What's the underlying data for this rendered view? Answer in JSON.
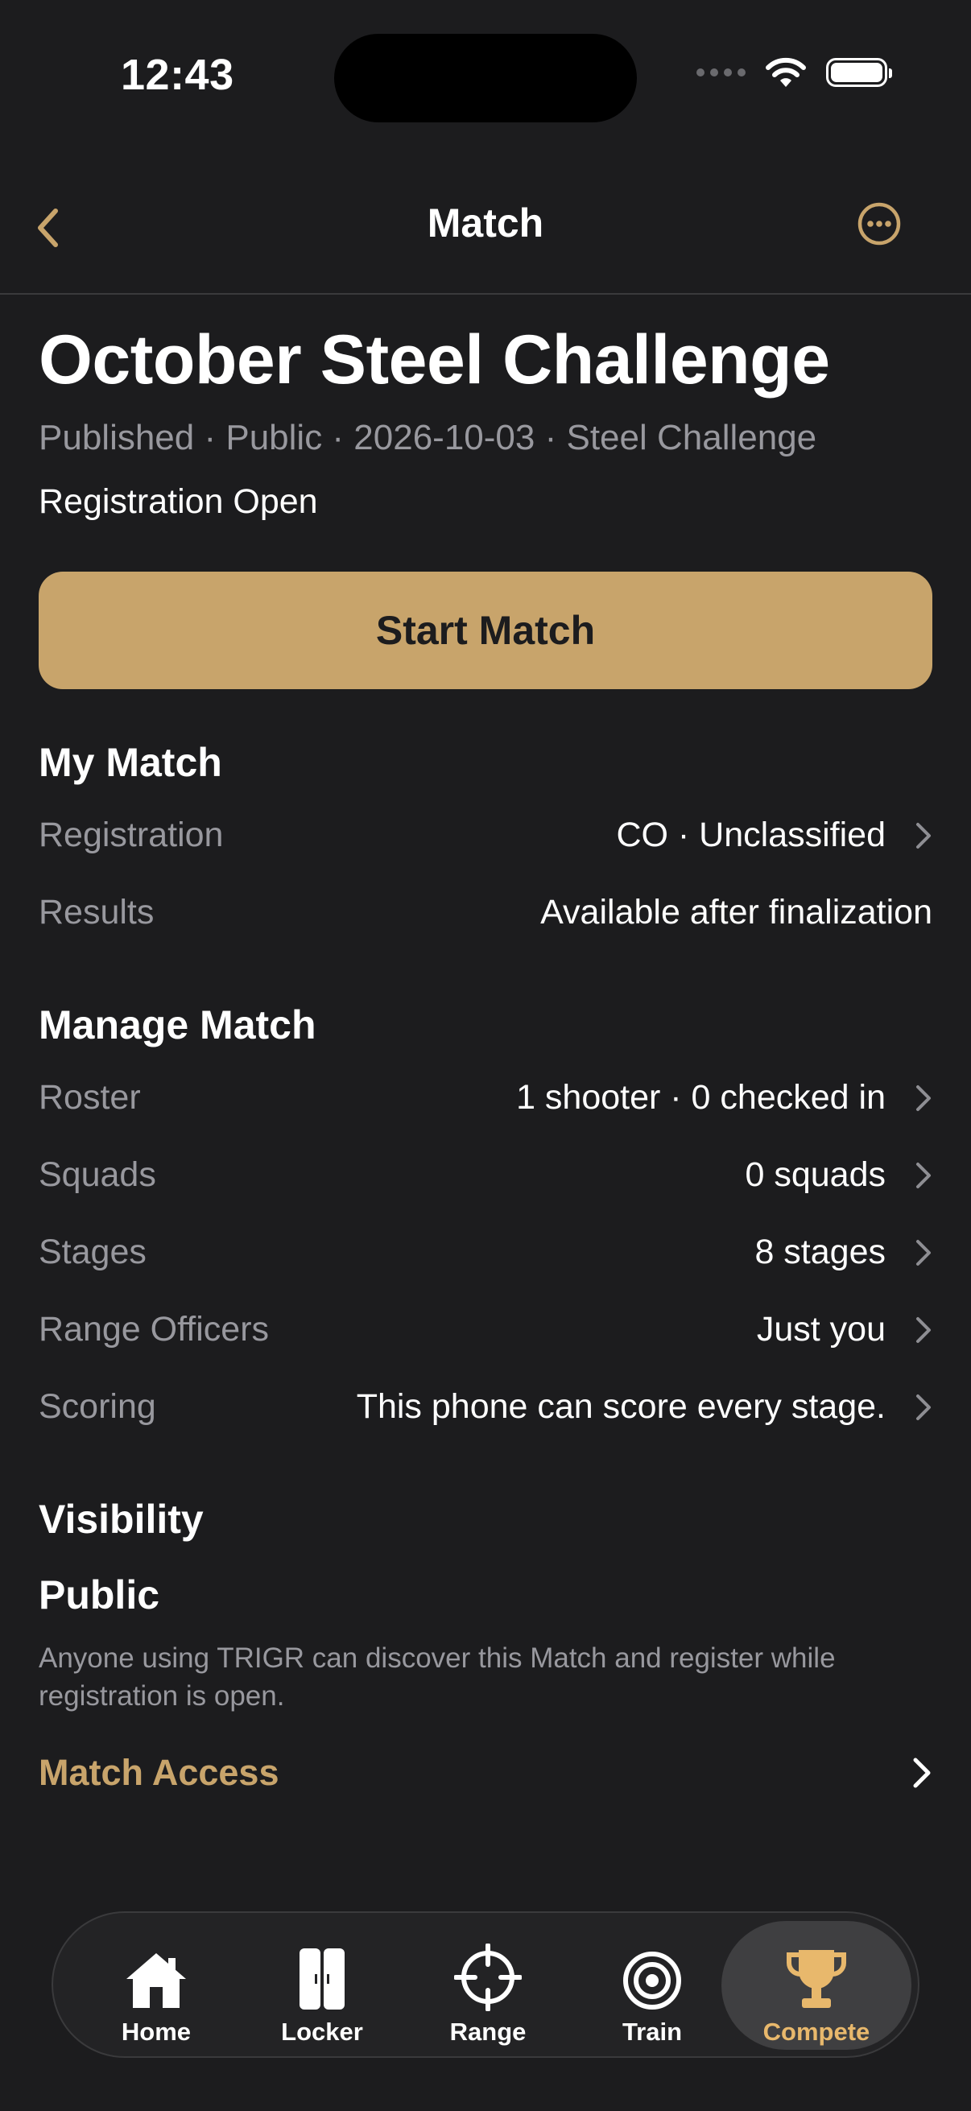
{
  "status_bar": {
    "time": "12:43"
  },
  "nav": {
    "title": "Match"
  },
  "match": {
    "title": "October Steel Challenge",
    "meta": "Published · Public · 2026-10-03 · Steel Challenge",
    "status": "Registration Open",
    "start_button": "Start Match"
  },
  "my_match": {
    "title": "My Match",
    "rows": [
      {
        "label": "Registration",
        "value": "CO · Unclassified"
      },
      {
        "label": "Results",
        "value": "Available after finalization"
      }
    ]
  },
  "manage_match": {
    "title": "Manage Match",
    "rows": [
      {
        "label": "Roster",
        "value": "1 shooter · 0 checked in"
      },
      {
        "label": "Squads",
        "value": "0 squads"
      },
      {
        "label": "Stages",
        "value": "8 stages"
      },
      {
        "label": "Range Officers",
        "value": "Just you"
      },
      {
        "label": "Scoring",
        "value": "This phone can score every stage."
      }
    ]
  },
  "visibility": {
    "title": "Visibility",
    "value": "Public",
    "description": "Anyone using TRIGR can discover this Match and register while registration is open.",
    "access_label": "Match Access"
  },
  "tabs": [
    {
      "label": "Home",
      "icon": "house-icon"
    },
    {
      "label": "Locker",
      "icon": "locker-icon"
    },
    {
      "label": "Range",
      "icon": "crosshair-icon"
    },
    {
      "label": "Train",
      "icon": "target-icon"
    },
    {
      "label": "Compete",
      "icon": "trophy-icon",
      "active": true
    }
  ],
  "colors": {
    "accent": "#c8a46b",
    "background": "#1c1c1e",
    "secondary_text": "#98989e",
    "active_tab": "#e8b86c"
  }
}
